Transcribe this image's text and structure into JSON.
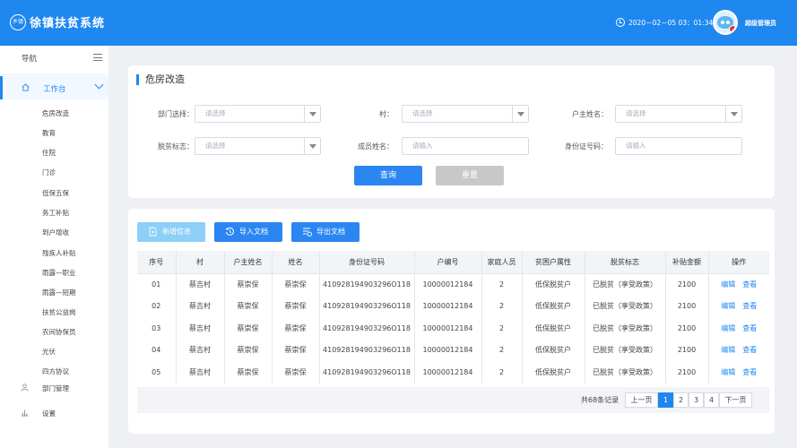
{
  "header": {
    "logo_text": "乡镇",
    "app_title": "徐镇扶贫系统",
    "datetime": "2020－02－05  03：01:34",
    "username": "超级管理员"
  },
  "sidebar": {
    "nav_title": "导航",
    "workbench_label": "工作台",
    "sub_items": [
      "危房改造",
      "教育",
      "住院",
      "门诊",
      "低保五保",
      "务工补贴",
      "到户增收",
      "残疾人补贴",
      "雨露—职业",
      "雨露—短期",
      "扶贫公益岗",
      "农间协保员",
      "光伏",
      "四方协议"
    ],
    "dept_label": "部门管理",
    "settings_label": "设置"
  },
  "search": {
    "title": "危房改造",
    "dept_label": "部门选择：",
    "dept_placeholder": "请选择",
    "village_label": "村：",
    "village_placeholder": "请选择",
    "owner_label": "户主姓名：",
    "owner_placeholder": "请选择",
    "poverty_label": "脱贫标志：",
    "poverty_placeholder": "请选择",
    "member_label": "成员姓名：",
    "member_placeholder": "请输入",
    "id_label": "身份证号码：",
    "id_placeholder": "请输入",
    "query_label": "查询",
    "reset_label": "重置"
  },
  "toolbar": {
    "new_label": "新增信息",
    "import_label": "导入文档",
    "export_label": "导出文档"
  },
  "table": {
    "headers": [
      "序号",
      "村",
      "户主姓名",
      "姓名",
      "身份证号码",
      "户编号",
      "家庭人员",
      "贫困户属性",
      "脱贫标志",
      "补贴金额",
      "操作"
    ],
    "rows": [
      [
        "01",
        "蔡吉村",
        "蔡崇保",
        "蔡崇保",
        "410928194903296O118",
        "10000012184",
        "2",
        "低保脱贫户",
        "已脱贫（享受政策）",
        "2100"
      ],
      [
        "02",
        "蔡吉村",
        "蔡崇保",
        "蔡崇保",
        "410928194903296O118",
        "10000012184",
        "2",
        "低保脱贫户",
        "已脱贫（享受政策）",
        "2100"
      ],
      [
        "03",
        "蔡吉村",
        "蔡崇保",
        "蔡崇保",
        "410928194903296O118",
        "10000012184",
        "2",
        "低保脱贫户",
        "已脱贫（享受政策）",
        "2100"
      ],
      [
        "04",
        "蔡吉村",
        "蔡崇保",
        "蔡崇保",
        "410928194903296O118",
        "10000012184",
        "2",
        "低保脱贫户",
        "已脱贫（享受政策）",
        "2100"
      ],
      [
        "05",
        "蔡吉村",
        "蔡崇保",
        "蔡崇保",
        "410928194903296O118",
        "10000012184",
        "2",
        "低保脱贫户",
        "已脱贫（享受政策）",
        "2100"
      ]
    ],
    "edit_label": "编辑",
    "view_label": "查看"
  },
  "pager": {
    "total": "共68条记录",
    "prev": "上一页",
    "pages": [
      "1",
      "2",
      "3",
      "4"
    ],
    "current": "1",
    "next": "下一页"
  },
  "colors": {
    "primary": "#1e88f0",
    "light_button": "#8ccff7",
    "reset_button": "#c8c8c8"
  }
}
